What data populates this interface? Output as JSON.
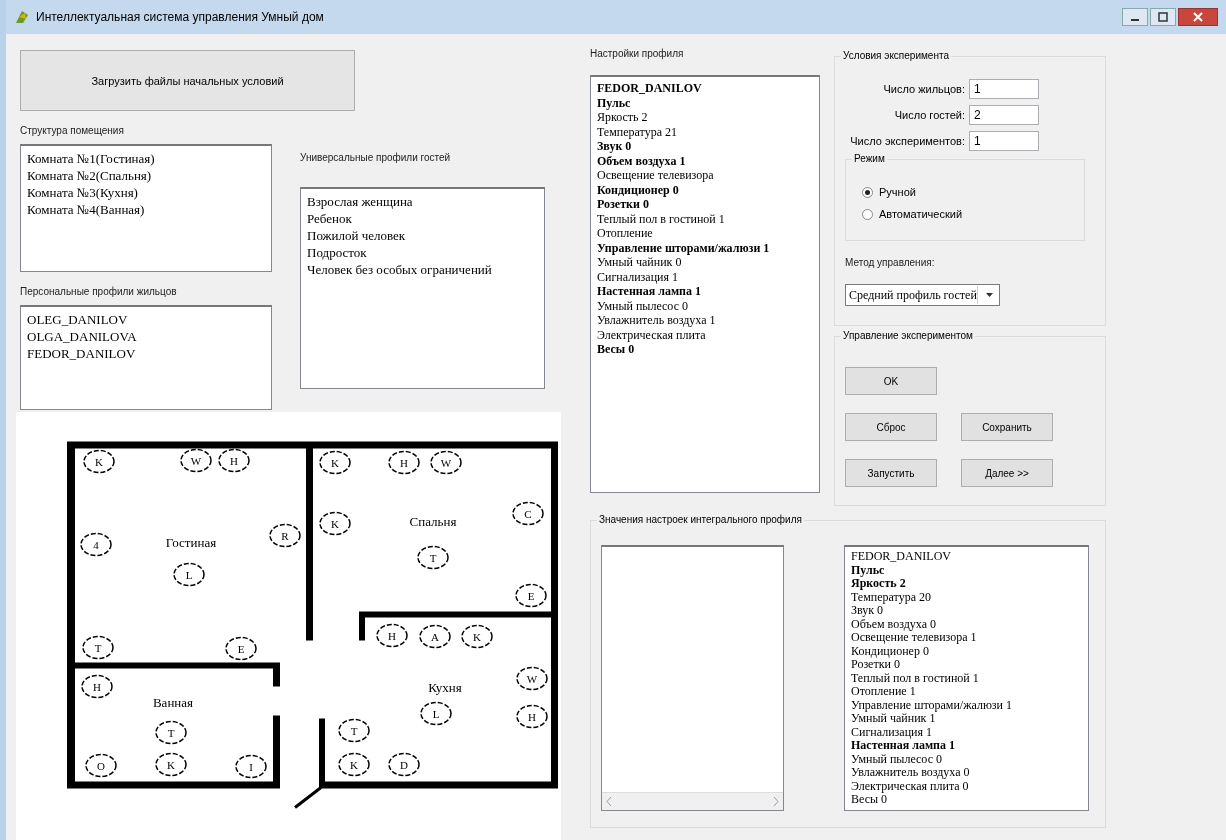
{
  "window": {
    "title": "Интеллектуальная система управления Умный дом"
  },
  "load_button": "Загрузить файлы начальных условий",
  "structure": {
    "label": "Структура помещения",
    "items": [
      "Комната №1(Гостиная)",
      "Комната №2(Спальня)",
      "Комната №3(Кухня)",
      "Комната №4(Ванная)"
    ]
  },
  "residents": {
    "label": "Персональные профили жильцов",
    "items": [
      "OLEG_DANILOV",
      "OLGA_DANILOVA",
      "FEDOR_DANILOV"
    ]
  },
  "guests": {
    "label": "Универсальные профили гостей",
    "items": [
      "Взрослая женщина",
      "Ребенок",
      "Пожилой человек",
      "Подросток",
      "Человек без особых ограничений"
    ]
  },
  "profile_settings": {
    "label": "Настройки профиля",
    "items": [
      {
        "text": "FEDOR_DANILOV",
        "bold": true
      },
      {
        "text": "Пульс",
        "bold": true
      },
      {
        "text": "Яркость 2",
        "bold": false
      },
      {
        "text": "Температура 21",
        "bold": false
      },
      {
        "text": "Звук 0",
        "bold": true
      },
      {
        "text": "Объем воздуха 1",
        "bold": true
      },
      {
        "text": "Освещение телевизора",
        "bold": false
      },
      {
        "text": "Кондиционер 0",
        "bold": true
      },
      {
        "text": "Розетки 0",
        "bold": true
      },
      {
        "text": "Теплый пол в гостиной 1",
        "bold": false
      },
      {
        "text": "Отопление",
        "bold": false
      },
      {
        "text": "Управление шторами/жалюзи 1",
        "bold": true
      },
      {
        "text": "Умный чайник 0",
        "bold": false
      },
      {
        "text": "Сигнализация 1",
        "bold": false
      },
      {
        "text": "Настенная лампа 1",
        "bold": true
      },
      {
        "text": "Умный пылесос 0",
        "bold": false
      },
      {
        "text": "Увлажнитель воздуха 1",
        "bold": false
      },
      {
        "text": "Электрическая плита",
        "bold": false
      },
      {
        "text": "Весы 0",
        "bold": true
      }
    ]
  },
  "conditions": {
    "title": "Условия эксперимента",
    "fields": [
      {
        "label": "Число жильцов:",
        "value": "1"
      },
      {
        "label": "Число гостей:",
        "value": "2"
      },
      {
        "label": "Число экспериментов:",
        "value": "1"
      }
    ],
    "mode": {
      "title": "Режим",
      "options": [
        {
          "label": "Ручной",
          "selected": true
        },
        {
          "label": "Автоматический",
          "selected": false
        }
      ]
    },
    "method_label": "Метод управления:",
    "method_value": "Средний профиль гостей"
  },
  "control": {
    "title": "Управление экспериментом",
    "buttons": [
      "OK",
      "Сброс",
      "Сохранить",
      "Запустить",
      "Далее >>"
    ]
  },
  "integral": {
    "title": "Значения настроек интегрального профиля",
    "items": [
      {
        "text": "FEDOR_DANILOV",
        "bold": false
      },
      {
        "text": "Пульс",
        "bold": true
      },
      {
        "text": "Яркость 2",
        "bold": true
      },
      {
        "text": "Температура 20",
        "bold": false
      },
      {
        "text": "Звук 0",
        "bold": false
      },
      {
        "text": "Объем воздуха 0",
        "bold": false
      },
      {
        "text": "Освещение телевизора 1",
        "bold": false
      },
      {
        "text": "Кондиционер 0",
        "bold": false
      },
      {
        "text": "Розетки 0",
        "bold": false
      },
      {
        "text": "Теплый пол в гостиной 1",
        "bold": false
      },
      {
        "text": "Отопление 1",
        "bold": false
      },
      {
        "text": "Управление шторами/жалюзи 1",
        "bold": false
      },
      {
        "text": "Умный чайник 1",
        "bold": false
      },
      {
        "text": "Сигнализация 1",
        "bold": false
      },
      {
        "text": "Настенная лампа 1",
        "bold": true
      },
      {
        "text": "Умный пылесос 0",
        "bold": false
      },
      {
        "text": "Увлажнитель воздуха 0",
        "bold": false
      },
      {
        "text": "Электрическая плита 0",
        "bold": false
      },
      {
        "text": "Весы 0",
        "bold": false
      }
    ]
  },
  "floor_plan": {
    "rooms": [
      {
        "name": "Гостиная",
        "devices": [
          "K",
          "W",
          "H",
          "4",
          "R",
          "L",
          "T",
          "E"
        ]
      },
      {
        "name": "Спальня",
        "devices": [
          "K",
          "H",
          "W",
          "K",
          "C",
          "T",
          "E"
        ]
      },
      {
        "name": "Ванная",
        "devices": [
          "H",
          "T",
          "O",
          "K",
          "I"
        ]
      },
      {
        "name": "Кухня",
        "devices": [
          "H",
          "A",
          "K",
          "W",
          "H",
          "T",
          "K",
          "D",
          "L"
        ]
      }
    ]
  }
}
